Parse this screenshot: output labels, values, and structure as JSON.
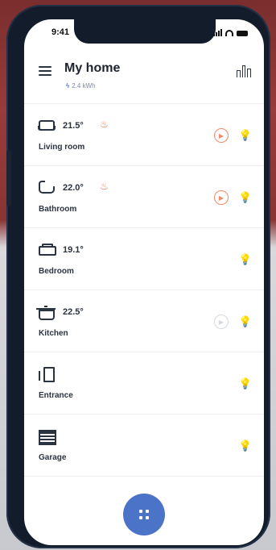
{
  "status_bar": {
    "time": "9:41"
  },
  "header": {
    "title": "My home",
    "energy": "2.4 kWh"
  },
  "rooms": [
    {
      "name": "Living room",
      "temp": "21.5°",
      "heating": true,
      "play_active": true,
      "light_on": true,
      "icon": "sofa-icon"
    },
    {
      "name": "Bathroom",
      "temp": "22.0°",
      "heating": true,
      "play_active": true,
      "light_on": true,
      "icon": "bathtub-icon"
    },
    {
      "name": "Bedroom",
      "temp": "19.1°",
      "heating": false,
      "play_active": null,
      "light_on": false,
      "icon": "bed-icon"
    },
    {
      "name": "Kitchen",
      "temp": "22.5°",
      "heating": false,
      "play_active": false,
      "light_on": true,
      "icon": "cooking-pot-icon"
    },
    {
      "name": "Entrance",
      "temp": "",
      "heating": false,
      "play_active": null,
      "light_on": false,
      "icon": "door-icon"
    },
    {
      "name": "Garage",
      "temp": "",
      "heating": false,
      "play_active": null,
      "light_on": false,
      "icon": "garage-icon"
    }
  ],
  "colors": {
    "accent": "#4b73c8",
    "heating": "#e8704a",
    "light": "#f5c84a"
  }
}
